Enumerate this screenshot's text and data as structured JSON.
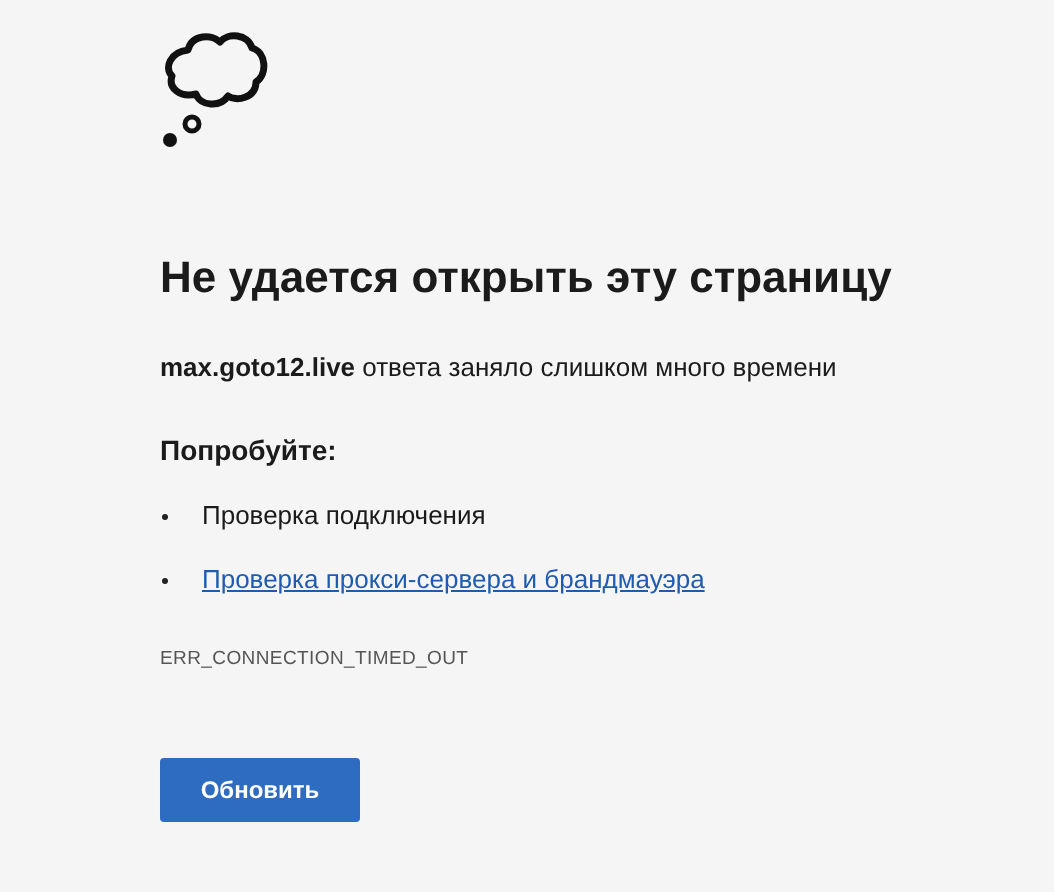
{
  "title": "Не удается открыть эту страницу",
  "message": "**max.goto12.live** ответа заняло слишком много времени",
  "suggestions_heading": "Попробуйте:",
  "suggestions": [
    {
      "kind": "text",
      "text": "Проверка подключения"
    },
    {
      "kind": "link",
      "text": "Проверка прокси-сервера и брандмауэра"
    }
  ],
  "error_code": "ERR_CONNECTION_TIMED_OUT",
  "button": "Обновить"
}
